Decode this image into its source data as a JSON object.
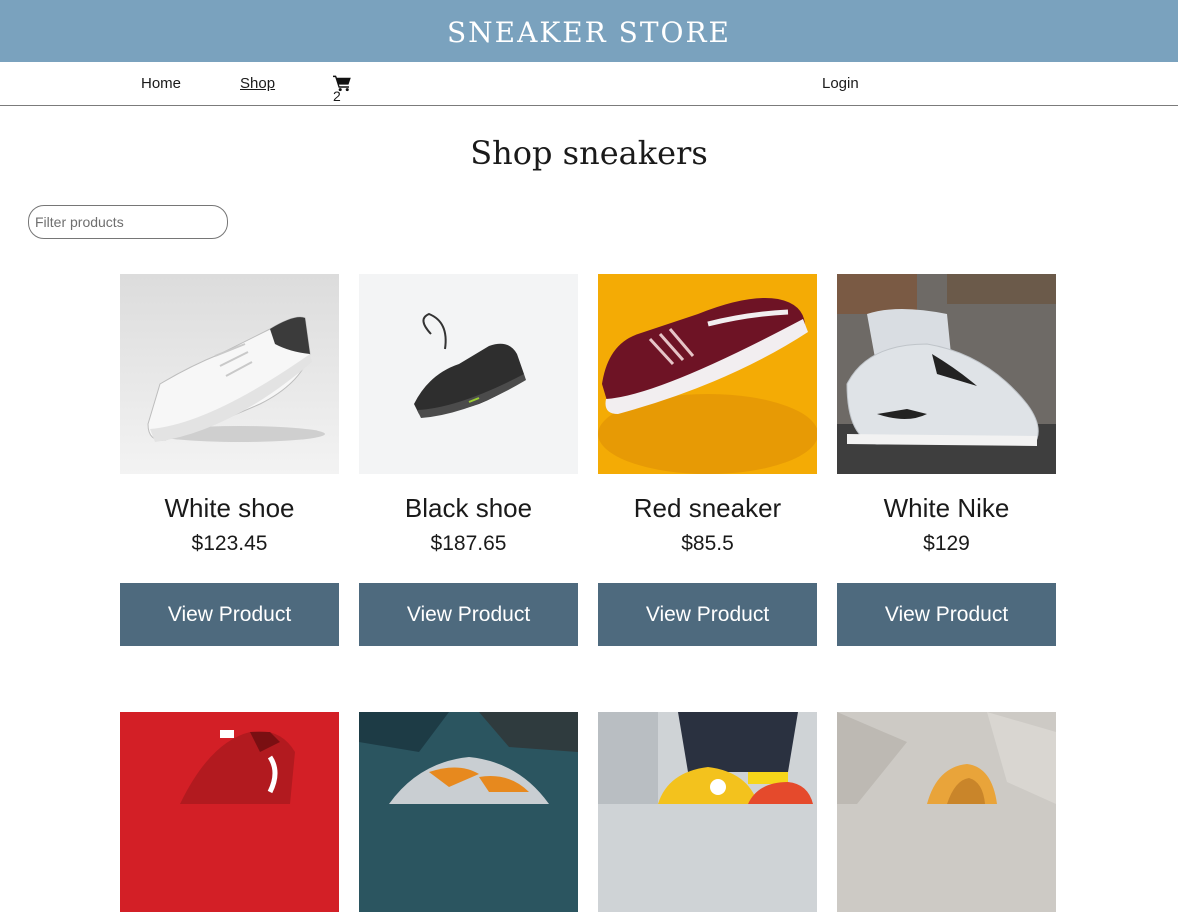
{
  "header": {
    "brand": "SNEAKER STORE"
  },
  "nav": {
    "home": "Home",
    "shop": "Shop",
    "cart_count": "2",
    "login": "Login"
  },
  "page": {
    "title": "Shop sneakers",
    "filter_placeholder": "Filter products"
  },
  "products": [
    {
      "name": "White shoe",
      "price": "$123.45",
      "button": "View Product"
    },
    {
      "name": "Black shoe",
      "price": "$187.65",
      "button": "View Product"
    },
    {
      "name": "Red sneaker",
      "price": "$85.5",
      "button": "View Product"
    },
    {
      "name": "White Nike",
      "price": "$129",
      "button": "View Product"
    }
  ],
  "icons": {
    "cart": "shopping-cart-icon"
  },
  "colors": {
    "header_bg": "#7aa2be",
    "button_bg": "#4e6a7e"
  }
}
